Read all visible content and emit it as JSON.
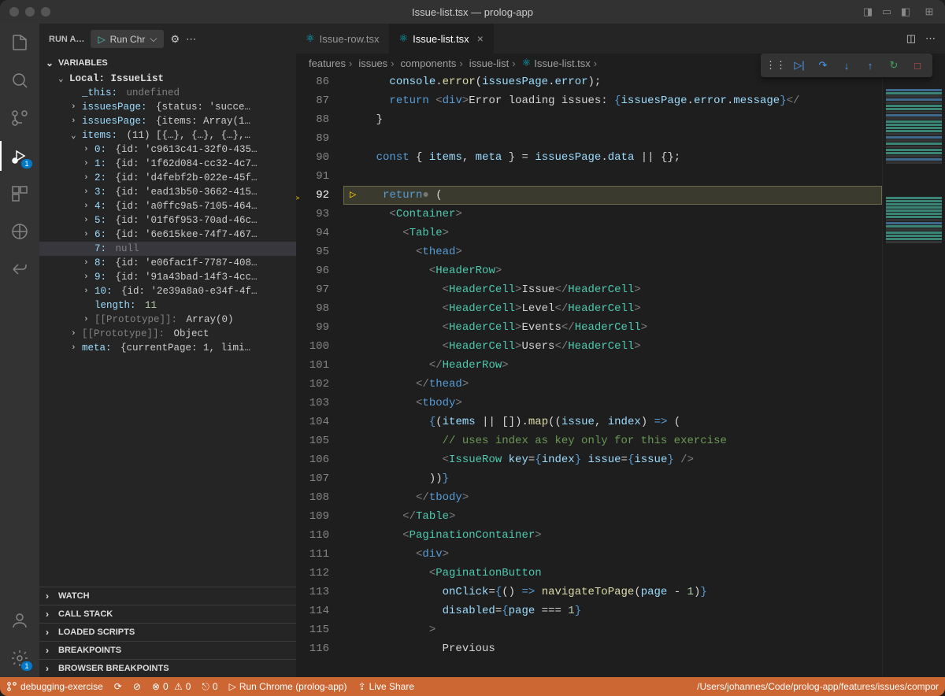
{
  "window": {
    "title": "Issue-list.tsx — prolog-app"
  },
  "sidebar": {
    "run_label": "RUN A…",
    "run_config": "Run Chr",
    "section_variables": "VARIABLES",
    "scope_label": "Local: IssueList",
    "vars": {
      "this": {
        "name": "_this:",
        "value": "undefined"
      },
      "issuesPage1": {
        "name": "issuesPage:",
        "value": "{status: 'succe…"
      },
      "issuesPage2": {
        "name": "issuesPage:",
        "value": "{items: Array(1…"
      },
      "items_header": {
        "name": "items:",
        "value": "(11) [{…}, {…}, {…},…"
      },
      "items": [
        {
          "idx": "0:",
          "value": "{id: 'c9613c41-32f0-435…"
        },
        {
          "idx": "1:",
          "value": "{id: '1f62d084-cc32-4c7…"
        },
        {
          "idx": "2:",
          "value": "{id: 'd4febf2b-022e-45f…"
        },
        {
          "idx": "3:",
          "value": "{id: 'ead13b50-3662-415…"
        },
        {
          "idx": "4:",
          "value": "{id: 'a0ffc9a5-7105-464…"
        },
        {
          "idx": "5:",
          "value": "{id: '01f6f953-70ad-46c…"
        },
        {
          "idx": "6:",
          "value": "{id: '6e615kee-74f7-467…"
        },
        {
          "idx": "7:",
          "value": "null"
        },
        {
          "idx": "8:",
          "value": "{id: 'e06fac1f-7787-408…"
        },
        {
          "idx": "9:",
          "value": "{id: '91a43bad-14f3-4cc…"
        },
        {
          "idx": "10:",
          "value": "{id: '2e39a8a0-e34f-4f…"
        }
      ],
      "length": {
        "name": "length:",
        "value": "11"
      },
      "proto1": {
        "name": "[[Prototype]]:",
        "value": "Array(0)"
      },
      "proto2": {
        "name": "[[Prototype]]:",
        "value": "Object"
      },
      "meta": {
        "name": "meta:",
        "value": "{currentPage: 1, limi…"
      }
    },
    "sections": {
      "watch": "WATCH",
      "callstack": "CALL STACK",
      "loaded": "LOADED SCRIPTS",
      "breakpoints": "BREAKPOINTS",
      "browser_breakpoints": "BROWSER BREAKPOINTS"
    }
  },
  "tabs": {
    "file1": "Issue-row.tsx",
    "file2": "Issue-list.tsx"
  },
  "breadcrumb": [
    "features",
    "issues",
    "components",
    "issue-list",
    "Issue-list.tsx"
  ],
  "editor": {
    "line_start": 86,
    "lines": [
      {
        "n": 86,
        "html": "      <span class='t-var'>console</span><span class='t-pun'>.</span><span class='t-fn'>error</span><span class='t-pun'>(</span><span class='t-var'>issuesPage</span><span class='t-pun'>.</span><span class='t-var'>error</span><span class='t-pun'>);</span>"
      },
      {
        "n": 87,
        "html": "      <span class='t-kw'>return</span> <span class='t-tag'>&lt;</span><span class='t-kw'>div</span><span class='t-tag'>&gt;</span><span class='t-txt'>Error loading issues: </span><span class='t-brace'>{</span><span class='t-var'>issuesPage</span><span class='t-pun'>.</span><span class='t-var'>error</span><span class='t-pun'>.</span><span class='t-var'>message</span><span class='t-brace'>}</span><span class='t-tag'>&lt;/</span>"
      },
      {
        "n": 88,
        "html": "    <span class='t-pun'>}</span>"
      },
      {
        "n": 89,
        "html": ""
      },
      {
        "n": 90,
        "html": "    <span class='t-kw'>const</span> <span class='t-pun'>{</span> <span class='t-var'>items</span><span class='t-pun'>,</span> <span class='t-var'>meta</span> <span class='t-pun'>} =</span> <span class='t-var'>issuesPage</span><span class='t-pun'>.</span><span class='t-var'>data</span> <span class='t-pun'>||</span> <span class='t-pun'>{};</span>"
      },
      {
        "n": 91,
        "html": ""
      },
      {
        "n": 92,
        "html": "    <span class='t-kw'>return</span><span class='t-pun' style='opacity:0.4'>●</span> <span class='t-pun'>(</span>",
        "current": true
      },
      {
        "n": 93,
        "html": "      <span class='t-tag'>&lt;</span><span class='t-comp'>Container</span><span class='t-tag'>&gt;</span>"
      },
      {
        "n": 94,
        "html": "        <span class='t-tag'>&lt;</span><span class='t-comp'>Table</span><span class='t-tag'>&gt;</span>"
      },
      {
        "n": 95,
        "html": "          <span class='t-tag'>&lt;</span><span class='t-kw'>thead</span><span class='t-tag'>&gt;</span>"
      },
      {
        "n": 96,
        "html": "            <span class='t-tag'>&lt;</span><span class='t-comp'>HeaderRow</span><span class='t-tag'>&gt;</span>"
      },
      {
        "n": 97,
        "html": "              <span class='t-tag'>&lt;</span><span class='t-comp'>HeaderCell</span><span class='t-tag'>&gt;</span><span class='t-txt'>Issue</span><span class='t-tag'>&lt;/</span><span class='t-comp'>HeaderCell</span><span class='t-tag'>&gt;</span>"
      },
      {
        "n": 98,
        "html": "              <span class='t-tag'>&lt;</span><span class='t-comp'>HeaderCell</span><span class='t-tag'>&gt;</span><span class='t-txt'>Level</span><span class='t-tag'>&lt;/</span><span class='t-comp'>HeaderCell</span><span class='t-tag'>&gt;</span>"
      },
      {
        "n": 99,
        "html": "              <span class='t-tag'>&lt;</span><span class='t-comp'>HeaderCell</span><span class='t-tag'>&gt;</span><span class='t-txt'>Events</span><span class='t-tag'>&lt;/</span><span class='t-comp'>HeaderCell</span><span class='t-tag'>&gt;</span>"
      },
      {
        "n": 100,
        "html": "              <span class='t-tag'>&lt;</span><span class='t-comp'>HeaderCell</span><span class='t-tag'>&gt;</span><span class='t-txt'>Users</span><span class='t-tag'>&lt;/</span><span class='t-comp'>HeaderCell</span><span class='t-tag'>&gt;</span>"
      },
      {
        "n": 101,
        "html": "            <span class='t-tag'>&lt;/</span><span class='t-comp'>HeaderRow</span><span class='t-tag'>&gt;</span>"
      },
      {
        "n": 102,
        "html": "          <span class='t-tag'>&lt;/</span><span class='t-kw'>thead</span><span class='t-tag'>&gt;</span>"
      },
      {
        "n": 103,
        "html": "          <span class='t-tag'>&lt;</span><span class='t-kw'>tbody</span><span class='t-tag'>&gt;</span>"
      },
      {
        "n": 104,
        "html": "            <span class='t-brace'>{</span><span class='t-pun'>(</span><span class='t-var'>items</span> <span class='t-pun'>||</span> <span class='t-pun'>[]).</span><span class='t-fn'>map</span><span class='t-pun'>((</span><span class='t-var'>issue</span><span class='t-pun'>,</span> <span class='t-var'>index</span><span class='t-pun'>)</span> <span class='t-kw'>=&gt;</span> <span class='t-pun'>(</span>"
      },
      {
        "n": 105,
        "html": "              <span class='t-cmt'>// uses index as key only for this exercise</span>"
      },
      {
        "n": 106,
        "html": "              <span class='t-tag'>&lt;</span><span class='t-comp'>IssueRow</span> <span class='t-attr'>key</span><span class='t-pun'>=</span><span class='t-brace'>{</span><span class='t-var'>index</span><span class='t-brace'>}</span> <span class='t-attr'>issue</span><span class='t-pun'>=</span><span class='t-brace'>{</span><span class='t-var'>issue</span><span class='t-brace'>}</span> <span class='t-tag'>/&gt;</span>"
      },
      {
        "n": 107,
        "html": "            <span class='t-pun'>))</span><span class='t-brace'>}</span>"
      },
      {
        "n": 108,
        "html": "          <span class='t-tag'>&lt;/</span><span class='t-kw'>tbody</span><span class='t-tag'>&gt;</span>"
      },
      {
        "n": 109,
        "html": "        <span class='t-tag'>&lt;/</span><span class='t-comp'>Table</span><span class='t-tag'>&gt;</span>"
      },
      {
        "n": 110,
        "html": "        <span class='t-tag'>&lt;</span><span class='t-comp'>PaginationContainer</span><span class='t-tag'>&gt;</span>"
      },
      {
        "n": 111,
        "html": "          <span class='t-tag'>&lt;</span><span class='t-kw'>div</span><span class='t-tag'>&gt;</span>"
      },
      {
        "n": 112,
        "html": "            <span class='t-tag'>&lt;</span><span class='t-comp'>PaginationButton</span>"
      },
      {
        "n": 113,
        "html": "              <span class='t-attr'>onClick</span><span class='t-pun'>=</span><span class='t-brace'>{</span><span class='t-pun'>()</span> <span class='t-kw'>=&gt;</span> <span class='t-fn'>navigateToPage</span><span class='t-pun'>(</span><span class='t-var'>page</span> <span class='t-pun'>-</span> <span class='t-num'>1</span><span class='t-pun'>)</span><span class='t-brace'>}</span>"
      },
      {
        "n": 114,
        "html": "              <span class='t-attr'>disabled</span><span class='t-pun'>=</span><span class='t-brace'>{</span><span class='t-var'>page</span> <span class='t-pun'>===</span> <span class='t-num'>1</span><span class='t-brace'>}</span>"
      },
      {
        "n": 115,
        "html": "            <span class='t-tag'>&gt;</span>"
      },
      {
        "n": 116,
        "html": "              <span class='t-txt'>Previous</span>"
      }
    ]
  },
  "statusbar": {
    "branch": "debugging-exercise",
    "errors": "0",
    "warnings": "0",
    "port": "0",
    "debug": "Run Chrome (prolog-app)",
    "liveshare": "Live Share",
    "path": "/Users/johannes/Code/prolog-app/features/issues/compor"
  }
}
